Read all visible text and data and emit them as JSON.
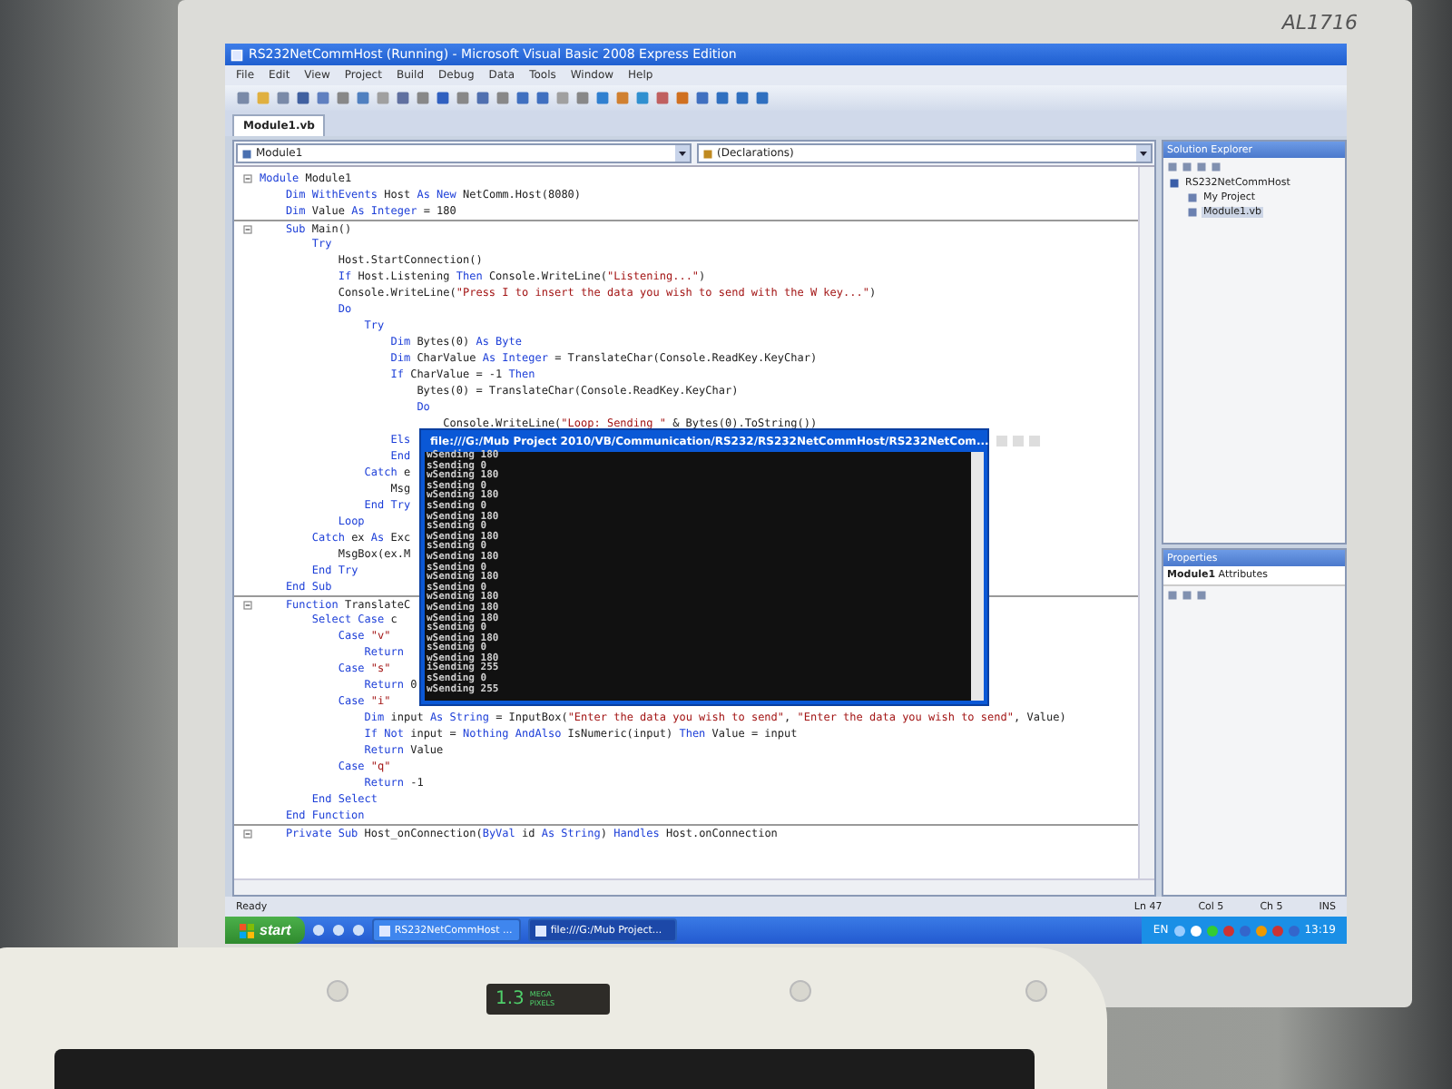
{
  "monitor": {
    "label": "AL1716"
  },
  "window": {
    "title": "RS232NetCommHost (Running) - Microsoft Visual Basic 2008 Express Edition"
  },
  "menu": [
    "File",
    "Edit",
    "View",
    "Project",
    "Build",
    "Debug",
    "Data",
    "Tools",
    "Window",
    "Help"
  ],
  "tabs": [
    {
      "label": "Module1.vb",
      "selected": true
    }
  ],
  "editor": {
    "object_dropdown": "Module1",
    "member_dropdown": "(Declarations)",
    "lines": [
      {
        "foldable": true,
        "tokens": [
          {
            "kind": "keyword",
            "text": "Module"
          },
          {
            "kind": "plain",
            "text": " Module1"
          }
        ],
        "children": [
          {
            "tokens": [
              {
                "kind": "keyword",
                "text": "Dim WithEvents"
              },
              {
                "kind": "plain",
                "text": " Host "
              },
              {
                "kind": "keyword",
                "text": "As New"
              },
              {
                "kind": "plain",
                "text": " NetComm.Host(8080)"
              }
            ]
          },
          {
            "tokens": [
              {
                "kind": "keyword",
                "text": "Dim"
              },
              {
                "kind": "plain",
                "text": " Value "
              },
              {
                "kind": "keyword",
                "text": "As Integer"
              },
              {
                "kind": "plain",
                "text": " = 180"
              }
            ]
          },
          {
            "foldable": true,
            "tokens": [
              {
                "kind": "keyword",
                "text": "Sub"
              },
              {
                "kind": "plain",
                "text": " Main()"
              }
            ],
            "children": [
              {
                "tokens": [
                  {
                    "kind": "keyword",
                    "text": "Try"
                  }
                ],
                "children": [
                  {
                    "tokens": [
                      {
                        "kind": "plain",
                        "text": "Host.StartConnection()"
                      }
                    ]
                  },
                  {
                    "tokens": [
                      {
                        "kind": "keyword",
                        "text": "If"
                      },
                      {
                        "kind": "plain",
                        "text": " Host.Listening "
                      },
                      {
                        "kind": "keyword",
                        "text": "Then"
                      },
                      {
                        "kind": "plain",
                        "text": " Console.WriteLine("
                      },
                      {
                        "kind": "string",
                        "text": "\"Listening...\""
                      },
                      {
                        "kind": "plain",
                        "text": ")"
                      }
                    ]
                  },
                  {
                    "tokens": [
                      {
                        "kind": "plain",
                        "text": "Console.WriteLine("
                      },
                      {
                        "kind": "string",
                        "text": "\"Press I to insert the data you wish to send with the W key...\""
                      },
                      {
                        "kind": "plain",
                        "text": ")"
                      }
                    ]
                  },
                  {
                    "tokens": [
                      {
                        "kind": "keyword",
                        "text": "Do"
                      }
                    ],
                    "children": [
                      {
                        "tokens": [
                          {
                            "kind": "keyword",
                            "text": "Try"
                          }
                        ],
                        "children": [
                          {
                            "tokens": [
                              {
                                "kind": "keyword",
                                "text": "Dim"
                              },
                              {
                                "kind": "plain",
                                "text": " Bytes(0) "
                              },
                              {
                                "kind": "keyword",
                                "text": "As Byte"
                              }
                            ]
                          },
                          {
                            "tokens": [
                              {
                                "kind": "keyword",
                                "text": "Dim"
                              },
                              {
                                "kind": "plain",
                                "text": " CharValue "
                              },
                              {
                                "kind": "keyword",
                                "text": "As Integer"
                              },
                              {
                                "kind": "plain",
                                "text": " = TranslateChar(Console.ReadKey.KeyChar)"
                              }
                            ]
                          },
                          {
                            "tokens": [
                              {
                                "kind": "keyword",
                                "text": "If"
                              },
                              {
                                "kind": "plain",
                                "text": " CharValue = -1 "
                              },
                              {
                                "kind": "keyword",
                                "text": "Then"
                              }
                            ],
                            "children": [
                              {
                                "tokens": [
                                  {
                                    "kind": "plain",
                                    "text": "Bytes(0) = TranslateChar(Console.ReadKey.KeyChar)"
                                  }
                                ]
                              },
                              {
                                "tokens": [
                                  {
                                    "kind": "keyword",
                                    "text": "Do"
                                  }
                                ],
                                "children": [
                                  {
                                    "tokens": [
                                      {
                                        "kind": "plain",
                                        "text": "Console.WriteLine("
                                      },
                                      {
                                        "kind": "string",
                                        "text": "\"Loop: Sending \""
                                      },
                                      {
                                        "kind": "plain",
                                        "text": " & Bytes(0).ToString())"
                                      }
                                    ]
                                  }
                                ]
                              }
                            ]
                          },
                          {
                            "tokens": [
                              {
                                "kind": "keyword",
                                "text": "Els"
                              }
                            ]
                          },
                          {
                            "tokens": [
                              {
                                "kind": "keyword",
                                "text": "End"
                              }
                            ]
                          }
                        ]
                      },
                      {
                        "tokens": [
                          {
                            "kind": "keyword",
                            "text": "Catch"
                          },
                          {
                            "kind": "plain",
                            "text": " e"
                          }
                        ],
                        "children": [
                          {
                            "tokens": [
                              {
                                "kind": "plain",
                                "text": "Msg"
                              }
                            ]
                          }
                        ]
                      },
                      {
                        "tokens": [
                          {
                            "kind": "keyword",
                            "text": "End Try"
                          }
                        ]
                      }
                    ]
                  },
                  {
                    "tokens": [
                      {
                        "kind": "keyword",
                        "text": "Loop"
                      }
                    ]
                  }
                ]
              },
              {
                "tokens": [
                  {
                    "kind": "keyword",
                    "text": "Catch"
                  },
                  {
                    "kind": "plain",
                    "text": " ex "
                  },
                  {
                    "kind": "keyword",
                    "text": "As"
                  },
                  {
                    "kind": "plain",
                    "text": " Exc"
                  }
                ],
                "children": [
                  {
                    "tokens": [
                      {
                        "kind": "plain",
                        "text": "MsgBox(ex.M"
                      }
                    ]
                  }
                ]
              },
              {
                "tokens": [
                  {
                    "kind": "keyword",
                    "text": "End Try"
                  }
                ]
              }
            ]
          },
          {
            "tokens": [
              {
                "kind": "keyword",
                "text": "End Sub"
              }
            ]
          },
          {
            "foldable": true,
            "tokens": [
              {
                "kind": "keyword",
                "text": "Function"
              },
              {
                "kind": "plain",
                "text": " TranslateC"
              }
            ],
            "children": [
              {
                "tokens": [
                  {
                    "kind": "keyword",
                    "text": "Select Case"
                  },
                  {
                    "kind": "plain",
                    "text": " c"
                  }
                ],
                "children": [
                  {
                    "tokens": [
                      {
                        "kind": "keyword",
                        "text": "Case"
                      },
                      {
                        "kind": "string",
                        "text": " \"v\""
                      }
                    ],
                    "children": [
                      {
                        "tokens": [
                          {
                            "kind": "keyword",
                            "text": "Return"
                          }
                        ]
                      }
                    ]
                  },
                  {
                    "tokens": [
                      {
                        "kind": "keyword",
                        "text": "Case"
                      },
                      {
                        "kind": "string",
                        "text": " \"s\""
                      }
                    ],
                    "children": [
                      {
                        "tokens": [
                          {
                            "kind": "keyword",
                            "text": "Return"
                          },
                          {
                            "kind": "plain",
                            "text": " 0"
                          }
                        ]
                      }
                    ]
                  },
                  {
                    "tokens": [
                      {
                        "kind": "keyword",
                        "text": "Case"
                      },
                      {
                        "kind": "string",
                        "text": " \"i\""
                      }
                    ],
                    "children": [
                      {
                        "tokens": [
                          {
                            "kind": "keyword",
                            "text": "Dim"
                          },
                          {
                            "kind": "plain",
                            "text": " input "
                          },
                          {
                            "kind": "keyword",
                            "text": "As String"
                          },
                          {
                            "kind": "plain",
                            "text": " = InputBox("
                          },
                          {
                            "kind": "string",
                            "text": "\"Enter the data you wish to send\""
                          },
                          {
                            "kind": "plain",
                            "text": ", "
                          },
                          {
                            "kind": "string",
                            "text": "\"Enter the data you wish to send\""
                          },
                          {
                            "kind": "plain",
                            "text": ", Value)"
                          }
                        ]
                      },
                      {
                        "tokens": [
                          {
                            "kind": "keyword",
                            "text": "If Not"
                          },
                          {
                            "kind": "plain",
                            "text": " input = "
                          },
                          {
                            "kind": "keyword",
                            "text": "Nothing AndAlso"
                          },
                          {
                            "kind": "plain",
                            "text": " IsNumeric(input) "
                          },
                          {
                            "kind": "keyword",
                            "text": "Then"
                          },
                          {
                            "kind": "plain",
                            "text": " Value = input"
                          }
                        ]
                      },
                      {
                        "tokens": [
                          {
                            "kind": "keyword",
                            "text": "Return"
                          },
                          {
                            "kind": "plain",
                            "text": " Value"
                          }
                        ]
                      }
                    ]
                  },
                  {
                    "tokens": [
                      {
                        "kind": "keyword",
                        "text": "Case"
                      },
                      {
                        "kind": "string",
                        "text": " \"q\""
                      }
                    ],
                    "children": [
                      {
                        "tokens": [
                          {
                            "kind": "keyword",
                            "text": "Return"
                          },
                          {
                            "kind": "plain",
                            "text": " -1"
                          }
                        ]
                      }
                    ]
                  }
                ]
              },
              {
                "tokens": [
                  {
                    "kind": "keyword",
                    "text": "End Select"
                  }
                ]
              }
            ]
          },
          {
            "tokens": [
              {
                "kind": "keyword",
                "text": "End Function"
              }
            ]
          },
          {
            "foldable": true,
            "tokens": [
              {
                "kind": "keyword",
                "text": "Private Sub"
              },
              {
                "kind": "plain",
                "text": " Host_onConnection("
              },
              {
                "kind": "keyword",
                "text": "ByVal"
              },
              {
                "kind": "plain",
                "text": " id "
              },
              {
                "kind": "keyword",
                "text": "As String"
              },
              {
                "kind": "plain",
                "text": ") "
              },
              {
                "kind": "keyword",
                "text": "Handles"
              },
              {
                "kind": "plain",
                "text": " Host.onConnection"
              }
            ]
          }
        ]
      }
    ]
  },
  "console": {
    "title": "file:///G:/Mub Project 2010/VB/Communication/RS232/RS232NetCommHost/RS232NetCom...",
    "lines": [
      "wSending 180",
      "sSending 0",
      "wSending 180",
      "sSending 0",
      "wSending 180",
      "sSending 0",
      "wSending 180",
      "sSending 0",
      "wSending 180",
      "sSending 0",
      "wSending 180",
      "sSending 0",
      "wSending 180",
      "sSending 0",
      "wSending 180",
      "wSending 180",
      "wSending 180",
      "sSending 0",
      "wSending 180",
      "sSending 0",
      "wSending 180",
      "iSending 255",
      "sSending 0",
      "wSending 255"
    ]
  },
  "solution_explorer": {
    "title": "Solution Explorer",
    "items": [
      {
        "label": "RS232NetCommHost",
        "selected": false,
        "children": [
          {
            "label": "My Project",
            "selected": false
          },
          {
            "label": "Module1.vb",
            "selected": true
          }
        ]
      }
    ]
  },
  "properties": {
    "title": "Properties",
    "object": "Module1",
    "object_type": "Attributes"
  },
  "status_bar": {
    "text": "Ready",
    "fields": [
      "Ln 47",
      "Col 5",
      "Ch 5",
      "INS"
    ]
  },
  "taskbar": {
    "start": "start",
    "tasks": [
      {
        "label": "RS232NetCommHost ...",
        "selected": false
      },
      {
        "label": "file:///G:/Mub Project...",
        "selected": true
      }
    ],
    "language": "EN",
    "clock": "13:19"
  },
  "laptop": {
    "badge_number": "1.3",
    "badge_text": "MEGA PIXELS"
  }
}
